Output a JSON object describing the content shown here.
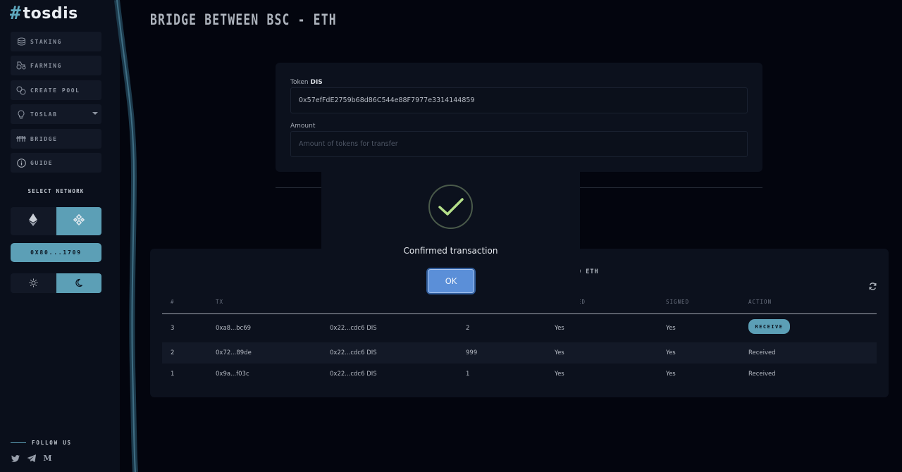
{
  "brand": {
    "hash": "#",
    "name": "tosdis"
  },
  "sidebar": {
    "items": [
      {
        "label": "STAKING",
        "icon": "coins-icon"
      },
      {
        "label": "FARMING",
        "icon": "tractor-icon"
      },
      {
        "label": "CREATE POOL",
        "icon": "pool-icon"
      },
      {
        "label": "TOSLAB",
        "icon": "lightbulb-icon",
        "has_dropdown": true
      },
      {
        "label": "BRIDGE",
        "icon": "bridge-icon"
      },
      {
        "label": "GUIDE",
        "icon": "info-icon"
      }
    ],
    "select_network_label": "SELECT NETWORK",
    "networks": [
      {
        "name": "ethereum",
        "icon": "ethereum-icon",
        "active": false
      },
      {
        "name": "bsc",
        "icon": "binance-icon",
        "active": true
      }
    ],
    "wallet_address": "0X80...1709",
    "themes": [
      {
        "name": "light",
        "icon": "sun-icon",
        "active": false
      },
      {
        "name": "dark",
        "icon": "moon-icon",
        "active": true
      }
    ],
    "follow_label": "FOLLOW US",
    "socials": [
      "twitter-icon",
      "telegram-icon",
      "medium-icon"
    ],
    "medium_glyph": "M"
  },
  "page": {
    "title": "BRIDGE BETWEEN BSC - ETH"
  },
  "form": {
    "token_label": "Token",
    "token_symbol": "DIS",
    "token_address": "0x57efFdE2759b68d86C544e88F7977e3314144859",
    "amount_label": "Amount",
    "amount_placeholder": "Amount of tokens for transfer",
    "amount_value": ""
  },
  "table": {
    "subtitle_visible": "O ETH",
    "headers": [
      "#",
      "TX",
      "",
      "",
      "ED",
      "SIGNED",
      "ACTION"
    ],
    "rows": [
      {
        "num": "3",
        "tx": "0xa8...bc69",
        "token": "0x22...cdc6 DIS",
        "amount": "2",
        "col5": "Yes",
        "signed": "Yes",
        "action": "RECEIVE",
        "action_is_button": true
      },
      {
        "num": "2",
        "tx": "0x72...89de",
        "token": "0x22...cdc6 DIS",
        "amount": "999",
        "col5": "Yes",
        "signed": "Yes",
        "action": "Received",
        "action_is_button": false
      },
      {
        "num": "1",
        "tx": "0x9a...f03c",
        "token": "0x22...cdc6 DIS",
        "amount": "1",
        "col5": "Yes",
        "signed": "Yes",
        "action": "Received",
        "action_is_button": false
      }
    ]
  },
  "modal": {
    "icon": "checkmark-icon",
    "message": "Confirmed transaction",
    "ok_label": "OK"
  },
  "colors": {
    "background": "#03050e",
    "sidebar": "#0a0f1b",
    "accent": "#5c9fb6",
    "check": "#b5e08a",
    "ok_button": "#5b8fd8"
  }
}
